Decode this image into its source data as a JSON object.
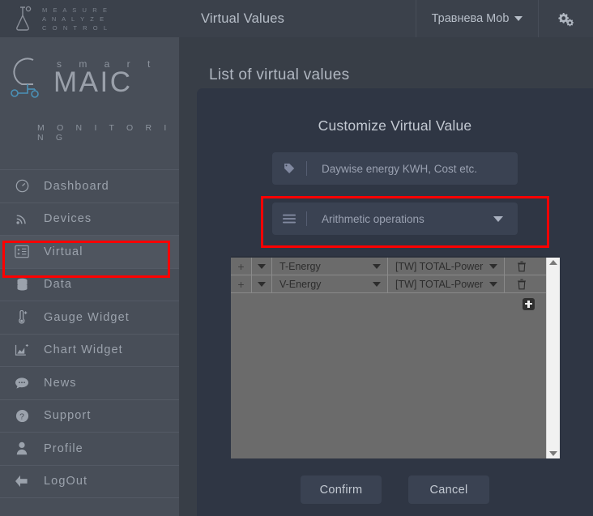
{
  "topbar": {
    "brand_lines": [
      "M E A S U R E",
      "A N A L Y Z E",
      "C O N T R O L"
    ],
    "title": "Virtual Values",
    "user": "Травнева Mob",
    "gear_icon": "cogs-icon",
    "caret_icon": "caret-down-icon"
  },
  "sidebar": {
    "logo": {
      "smart": "s m a r t",
      "maic": "MAIC",
      "monitoring": "M O N I T O R I N G"
    },
    "items": [
      {
        "label": "Dashboard",
        "icon": "gauge-icon",
        "active": false
      },
      {
        "label": "Devices",
        "icon": "rss-icon",
        "active": false
      },
      {
        "label": "Virtual",
        "icon": "virtual-grid-icon",
        "active": true
      },
      {
        "label": "Data",
        "icon": "database-icon",
        "active": false
      },
      {
        "label": "Gauge Widget",
        "icon": "thermometer-icon",
        "active": false
      },
      {
        "label": "Chart Widget",
        "icon": "chart-area-icon",
        "active": false
      },
      {
        "label": "News",
        "icon": "comment-icon",
        "active": false
      },
      {
        "label": "Support",
        "icon": "question-icon",
        "active": false
      },
      {
        "label": "Profile",
        "icon": "user-icon",
        "active": false
      },
      {
        "label": "LogOut",
        "icon": "logout-icon",
        "active": false
      }
    ]
  },
  "page": {
    "heading": "List of virtual values"
  },
  "modal": {
    "title": "Customize Virtual Value",
    "name_field": {
      "icon": "tag-icon",
      "value": "",
      "placeholder": "Daywise energy KWH, Cost etc."
    },
    "type_select": {
      "icon": "list-icon",
      "value": "Arithmetic operations",
      "caret": "chevron-down-icon"
    },
    "table": {
      "rows": [
        {
          "operator": "+",
          "name": "T-Energy",
          "source": "[TW] TOTAL-Power",
          "delete_icon": "trash-icon"
        },
        {
          "operator": "+",
          "name": "V-Energy",
          "source": "[TW] TOTAL-Power",
          "delete_icon": "trash-icon"
        }
      ],
      "add_button_icon": "plus-square-icon",
      "scrollbar": {
        "up_icon": "scroll-up-arrow-icon",
        "down_icon": "scroll-down-arrow-icon"
      }
    },
    "confirm_label": "Confirm",
    "cancel_label": "Cancel"
  },
  "annotations": {
    "color": "#ff0000",
    "boxes": [
      "sidebar-virtual-item",
      "type-select-dropdown"
    ]
  }
}
